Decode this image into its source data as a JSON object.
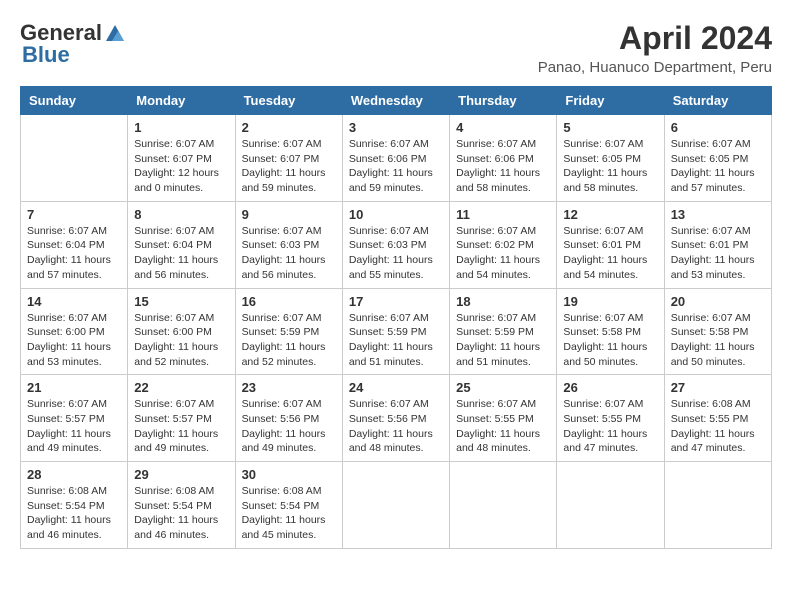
{
  "logo": {
    "general": "General",
    "blue": "Blue"
  },
  "header": {
    "title": "April 2024",
    "subtitle": "Panao, Huanuco Department, Peru"
  },
  "weekdays": [
    "Sunday",
    "Monday",
    "Tuesday",
    "Wednesday",
    "Thursday",
    "Friday",
    "Saturday"
  ],
  "weeks": [
    [
      {
        "date": "",
        "info": ""
      },
      {
        "date": "1",
        "info": "Sunrise: 6:07 AM\nSunset: 6:07 PM\nDaylight: 12 hours\nand 0 minutes."
      },
      {
        "date": "2",
        "info": "Sunrise: 6:07 AM\nSunset: 6:07 PM\nDaylight: 11 hours\nand 59 minutes."
      },
      {
        "date": "3",
        "info": "Sunrise: 6:07 AM\nSunset: 6:06 PM\nDaylight: 11 hours\nand 59 minutes."
      },
      {
        "date": "4",
        "info": "Sunrise: 6:07 AM\nSunset: 6:06 PM\nDaylight: 11 hours\nand 58 minutes."
      },
      {
        "date": "5",
        "info": "Sunrise: 6:07 AM\nSunset: 6:05 PM\nDaylight: 11 hours\nand 58 minutes."
      },
      {
        "date": "6",
        "info": "Sunrise: 6:07 AM\nSunset: 6:05 PM\nDaylight: 11 hours\nand 57 minutes."
      }
    ],
    [
      {
        "date": "7",
        "info": "Sunrise: 6:07 AM\nSunset: 6:04 PM\nDaylight: 11 hours\nand 57 minutes."
      },
      {
        "date": "8",
        "info": "Sunrise: 6:07 AM\nSunset: 6:04 PM\nDaylight: 11 hours\nand 56 minutes."
      },
      {
        "date": "9",
        "info": "Sunrise: 6:07 AM\nSunset: 6:03 PM\nDaylight: 11 hours\nand 56 minutes."
      },
      {
        "date": "10",
        "info": "Sunrise: 6:07 AM\nSunset: 6:03 PM\nDaylight: 11 hours\nand 55 minutes."
      },
      {
        "date": "11",
        "info": "Sunrise: 6:07 AM\nSunset: 6:02 PM\nDaylight: 11 hours\nand 54 minutes."
      },
      {
        "date": "12",
        "info": "Sunrise: 6:07 AM\nSunset: 6:01 PM\nDaylight: 11 hours\nand 54 minutes."
      },
      {
        "date": "13",
        "info": "Sunrise: 6:07 AM\nSunset: 6:01 PM\nDaylight: 11 hours\nand 53 minutes."
      }
    ],
    [
      {
        "date": "14",
        "info": "Sunrise: 6:07 AM\nSunset: 6:00 PM\nDaylight: 11 hours\nand 53 minutes."
      },
      {
        "date": "15",
        "info": "Sunrise: 6:07 AM\nSunset: 6:00 PM\nDaylight: 11 hours\nand 52 minutes."
      },
      {
        "date": "16",
        "info": "Sunrise: 6:07 AM\nSunset: 5:59 PM\nDaylight: 11 hours\nand 52 minutes."
      },
      {
        "date": "17",
        "info": "Sunrise: 6:07 AM\nSunset: 5:59 PM\nDaylight: 11 hours\nand 51 minutes."
      },
      {
        "date": "18",
        "info": "Sunrise: 6:07 AM\nSunset: 5:59 PM\nDaylight: 11 hours\nand 51 minutes."
      },
      {
        "date": "19",
        "info": "Sunrise: 6:07 AM\nSunset: 5:58 PM\nDaylight: 11 hours\nand 50 minutes."
      },
      {
        "date": "20",
        "info": "Sunrise: 6:07 AM\nSunset: 5:58 PM\nDaylight: 11 hours\nand 50 minutes."
      }
    ],
    [
      {
        "date": "21",
        "info": "Sunrise: 6:07 AM\nSunset: 5:57 PM\nDaylight: 11 hours\nand 49 minutes."
      },
      {
        "date": "22",
        "info": "Sunrise: 6:07 AM\nSunset: 5:57 PM\nDaylight: 11 hours\nand 49 minutes."
      },
      {
        "date": "23",
        "info": "Sunrise: 6:07 AM\nSunset: 5:56 PM\nDaylight: 11 hours\nand 49 minutes."
      },
      {
        "date": "24",
        "info": "Sunrise: 6:07 AM\nSunset: 5:56 PM\nDaylight: 11 hours\nand 48 minutes."
      },
      {
        "date": "25",
        "info": "Sunrise: 6:07 AM\nSunset: 5:55 PM\nDaylight: 11 hours\nand 48 minutes."
      },
      {
        "date": "26",
        "info": "Sunrise: 6:07 AM\nSunset: 5:55 PM\nDaylight: 11 hours\nand 47 minutes."
      },
      {
        "date": "27",
        "info": "Sunrise: 6:08 AM\nSunset: 5:55 PM\nDaylight: 11 hours\nand 47 minutes."
      }
    ],
    [
      {
        "date": "28",
        "info": "Sunrise: 6:08 AM\nSunset: 5:54 PM\nDaylight: 11 hours\nand 46 minutes."
      },
      {
        "date": "29",
        "info": "Sunrise: 6:08 AM\nSunset: 5:54 PM\nDaylight: 11 hours\nand 46 minutes."
      },
      {
        "date": "30",
        "info": "Sunrise: 6:08 AM\nSunset: 5:54 PM\nDaylight: 11 hours\nand 45 minutes."
      },
      {
        "date": "",
        "info": ""
      },
      {
        "date": "",
        "info": ""
      },
      {
        "date": "",
        "info": ""
      },
      {
        "date": "",
        "info": ""
      }
    ]
  ]
}
